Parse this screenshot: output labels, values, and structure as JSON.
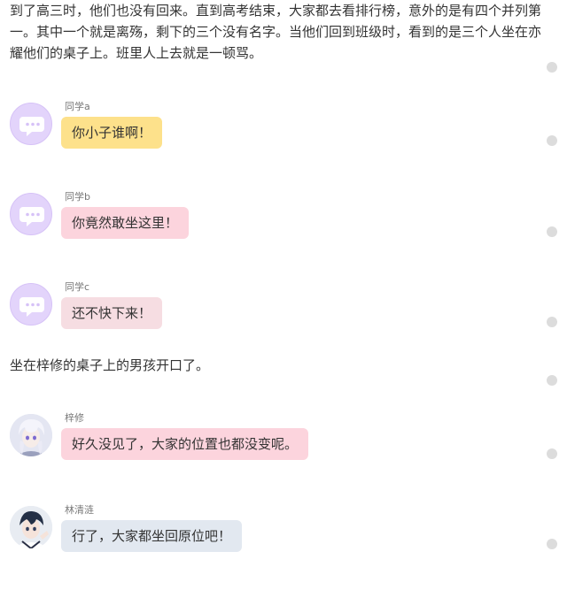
{
  "narration": {
    "intro": "到了高三时，他们也没有回来。直到高考结束，大家都去看排行榜，意外的是有四个并列第一。其中一个就是离殇，剩下的三个没有名字。当他们回到班级时，看到的是三个人坐在亦耀他们的桌子上。班里人上去就是一顿骂。",
    "mid": "坐在梓修的桌子上的男孩开口了。"
  },
  "messages": [
    {
      "sender": "同学a",
      "text": "你小子谁啊！",
      "bubble_color": "#fde18b",
      "avatar": "default-chat-avatar"
    },
    {
      "sender": "同学b",
      "text": "你竟然敢坐这里！",
      "bubble_color": "#fcd4dd",
      "avatar": "default-chat-avatar"
    },
    {
      "sender": "同学c",
      "text": "还不快下来！",
      "bubble_color": "#f6dde2",
      "avatar": "default-chat-avatar"
    },
    {
      "sender": "梓修",
      "text": "好久没见了，大家的位置也都没变呢。",
      "bubble_color": "#fcd4dd",
      "avatar": "white-hair-anime-avatar"
    },
    {
      "sender": "林清涟",
      "text": "行了，大家都坐回原位吧！",
      "bubble_color": "#e2e8f0",
      "avatar": "dark-hair-anime-avatar"
    }
  ],
  "colors": {
    "default_avatar_bg": "#e3d4fb",
    "side_dot": "#dcdcdc"
  }
}
